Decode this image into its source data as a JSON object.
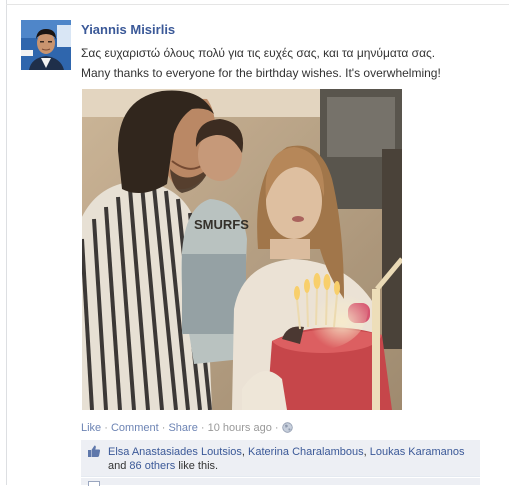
{
  "post": {
    "author_name": "Yiannis Misirlis",
    "message_greek": "Σας ευχαριστώ όλους πολύ για τις ευχές σας, και τα μηνύματα σας.",
    "message_english": "Many thanks to everyone for the birthday wishes. It's overwhelming!",
    "shirt_print": "SMURFS"
  },
  "actions": {
    "like_label": "Like",
    "comment_label": "Comment",
    "share_label": "Share",
    "sep": "·",
    "timestamp": "10 hours ago"
  },
  "likes": {
    "names": [
      "Elsa Anastasiades Loutsios",
      "Katerina Charalambous",
      "Loukas Karamanos"
    ],
    "comma": ",",
    "and_word": "and",
    "others_count": "86 others",
    "suffix": "like this."
  },
  "colors": {
    "link": "#3b5998",
    "action_link": "#6d84b4",
    "likes_bg": "#edeff4"
  }
}
